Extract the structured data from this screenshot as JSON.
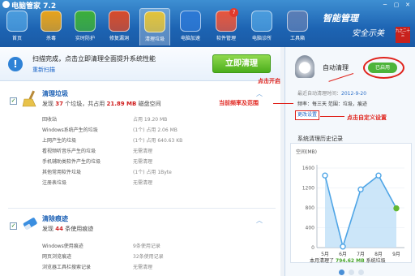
{
  "window": {
    "title": "电脑管家 7.2",
    "controls": [
      "─",
      "▢",
      "✕"
    ]
  },
  "nav": [
    {
      "label": "首页",
      "icon": "home-icon",
      "color": "#4a9bdc"
    },
    {
      "label": "杀毒",
      "icon": "lightning-shield-icon",
      "color": "#e7a21b"
    },
    {
      "label": "实时防护",
      "icon": "shield-icon",
      "color": "#3cae3a"
    },
    {
      "label": "修复漏洞",
      "icon": "patch-icon",
      "color": "#d74a2a"
    },
    {
      "label": "清理垃圾",
      "icon": "broom-icon",
      "color": "#e2c23a"
    },
    {
      "label": "电脑加速",
      "icon": "rocket-icon",
      "color": "#2c78d4"
    },
    {
      "label": "软件管理",
      "icon": "apps-icon",
      "color": "#e7553c"
    },
    {
      "label": "电脑诊所",
      "icon": "monitor-icon",
      "color": "#4a9bdc"
    },
    {
      "label": "工具箱",
      "icon": "toolbox-icon",
      "color": "#5a7db5"
    }
  ],
  "nav_badge": "7",
  "slogan": {
    "line1": "智能管理",
    "line2": "安全示美"
  },
  "ribbon": "九之二十三",
  "scan": {
    "message": "扫描完成，点击立即清理全面提升系统性能",
    "rescan": "重新扫描",
    "button": "立即清理"
  },
  "junk": {
    "title": "清理垃圾",
    "summary_pre": "发现",
    "count": "37",
    "summary_mid": "个垃圾，共占用",
    "size": "21.89 MB",
    "summary_post": "磁盘空间",
    "rows": [
      {
        "label": "回收站",
        "value": "占用 19.20 MB"
      },
      {
        "label": "Windows系统产生的垃圾",
        "value": "(1个)  占用 2.06 MB"
      },
      {
        "label": "上网产生的垃圾",
        "value": "(1个)  占用 640.63 KB"
      },
      {
        "label": "看视频听音乐产生的垃圾",
        "value": "无需清理"
      },
      {
        "label": "手机辅助类软件产生的垃圾",
        "value": "无需清理"
      },
      {
        "label": "其他常用软件垃圾",
        "value": "(1个)  占用 1Byte"
      },
      {
        "label": "注册表垃圾",
        "value": "无需清理"
      }
    ]
  },
  "traces": {
    "title": "清除痕迹",
    "summary_pre": "发现",
    "count": "44",
    "summary_post": "条使用痕迹",
    "rows": [
      {
        "label": "Windows使用痕迹",
        "value": "9条使用记录"
      },
      {
        "label": "网页浏览痕迹",
        "value": "32条使用记录"
      },
      {
        "label": "浏览器工具栏搜索记录",
        "value": "无需清理"
      }
    ]
  },
  "right": {
    "auto_title": "自动清理",
    "toggle": "已启用",
    "last_label": "最近自动清理时间：",
    "last_date": "2012-9-20",
    "freq": "频率：每三天   范围：垃圾，痕迹",
    "change": "更改设置",
    "history": "系统清理历史记录",
    "summary_pre": "本月清理了",
    "summary_val": "794.62 MB",
    "summary_post": "系统垃圾"
  },
  "annotations": {
    "open": "点击开启",
    "freq": "当前频率及范围",
    "custom": "点击自定义设置"
  },
  "chart_data": {
    "type": "area",
    "categories": [
      "5月",
      "6月",
      "7月",
      "8月",
      "9月"
    ],
    "values": [
      1450,
      20,
      1170,
      1450,
      790
    ],
    "ylabel": "空间(MB)",
    "yticks": [
      0,
      400,
      800,
      1200,
      1600
    ],
    "ylim": [
      0,
      1600
    ],
    "color": "#4fa5e6",
    "last_point_color": "#62b833"
  }
}
